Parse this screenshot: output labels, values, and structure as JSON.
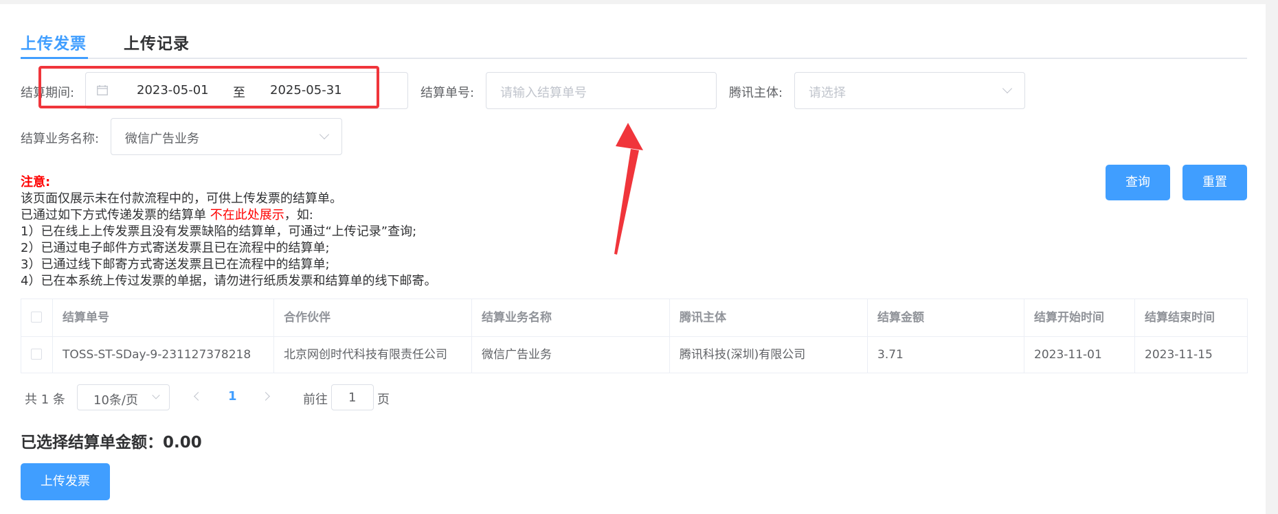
{
  "tabs": {
    "upload": "上传发票",
    "records": "上传记录"
  },
  "filters": {
    "period_label": "结算期间:",
    "start_date": "2023-05-01",
    "range_sep": "至",
    "end_date": "2025-05-31",
    "settle_no_label": "结算单号:",
    "settle_no_placeholder": "请输入结算单号",
    "entity_label": "腾讯主体:",
    "entity_placeholder": "请选择",
    "business_label": "结算业务名称:",
    "business_value": "微信广告业务"
  },
  "buttons": {
    "query": "查询",
    "reset": "重置",
    "upload": "上传发票"
  },
  "notice": {
    "title": "注意:",
    "line1": "该页面仅展示未在付款流程中的，可供上传发票的结算单。",
    "line2_a": "已通过如下方式传递发票的结算单 ",
    "line2_red": "不在此处展示",
    "line2_b": "，如:",
    "item1": "1）已在线上上传发票且没有发票缺陷的结算单，可通过“上传记录”查询;",
    "item2": "2）已通过电子邮件方式寄送发票且已在流程中的结算单;",
    "item3": "3）已通过线下邮寄方式寄送发票且已在流程中的结算单;",
    "item4": "4）已在本系统上传过发票的单据，请勿进行纸质发票和结算单的线下邮寄。"
  },
  "table": {
    "headers": [
      "结算单号",
      "合作伙伴",
      "结算业务名称",
      "腾讯主体",
      "结算金额",
      "结算开始时间",
      "结算结束时间"
    ],
    "rows": [
      [
        "TOSS-ST-SDay-9-231127378218",
        "北京网创时代科技有限责任公司",
        "微信广告业务",
        "腾讯科技(深圳)有限公司",
        "3.71",
        "2023-11-01",
        "2023-11-15"
      ]
    ]
  },
  "pagination": {
    "total": "共 1 条",
    "page_size": "10条/页",
    "current_page": "1",
    "goto_label": "前往",
    "goto_value": "1",
    "page_suffix": "页"
  },
  "summary": {
    "selected_amount": "已选择结算单金额：0.00"
  },
  "colors": {
    "accent": "#409eff",
    "annotation": "#f0353b",
    "warning": "#ff0000"
  }
}
